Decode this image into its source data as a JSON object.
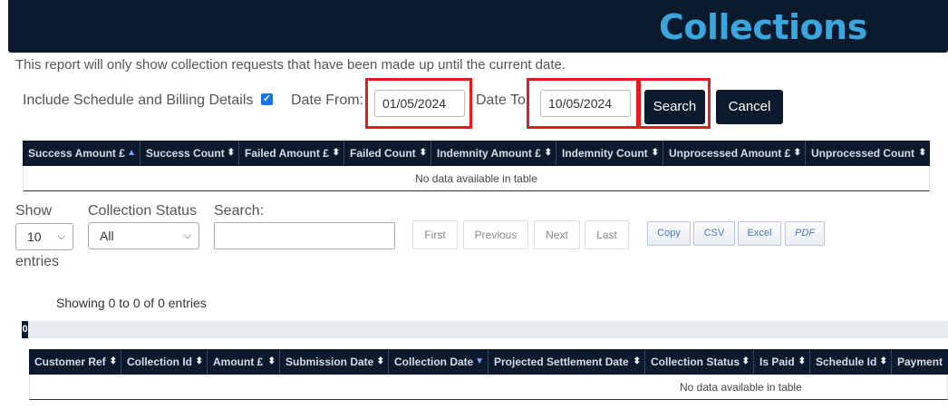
{
  "header": {
    "title": "Collections"
  },
  "note": "This report will only show collection requests that have been made up until the current date.",
  "filters": {
    "include_label": "Include Schedule and Billing Details",
    "include_checked": true,
    "date_from_label": "Date From:",
    "date_from_value": "01/05/2024",
    "date_to_label": "Date To",
    "date_to_value": "10/05/2024",
    "search_label": "Search",
    "cancel_label": "Cancel"
  },
  "summary_table": {
    "columns": [
      "Success Amount £",
      "Success Count",
      "Failed Amount £",
      "Failed Count",
      "Indemnity Amount £",
      "Indemnity Count",
      "Unprocessed Amount £",
      "Unprocessed Count"
    ],
    "empty_text": "No data available in table"
  },
  "controls": {
    "show_label": "Show",
    "show_value": "10",
    "entries_label": "entries",
    "status_label": "Collection Status",
    "status_value": "All",
    "search_label": "Search:",
    "search_value": "",
    "pager": [
      "First",
      "Previous",
      "Next",
      "Last"
    ],
    "export": [
      "Copy",
      "CSV",
      "Excel",
      "PDF"
    ],
    "showing_text": "Showing 0 to 0 of 0 entries",
    "scroll_label": "0"
  },
  "main_table": {
    "columns": [
      "Customer Ref",
      "Collection Id",
      "Amount £",
      "Submission Date",
      "Collection Date",
      "Projected Settlement Date",
      "Collection Status",
      "Is Paid",
      "Schedule Id",
      "Payment"
    ],
    "empty_text": "No data available in table"
  },
  "colors": {
    "header_bg": "#0c1a2e",
    "title": "#3aa6dd",
    "highlight": "#e21b23"
  }
}
